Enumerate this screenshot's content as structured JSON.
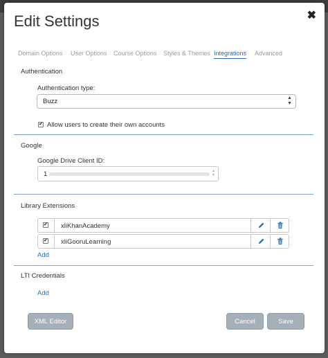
{
  "dialog": {
    "title": "Edit Settings",
    "close_glyph": "✖"
  },
  "tabs": [
    {
      "label": "Domain Options",
      "active": false
    },
    {
      "label": "User Options",
      "active": false
    },
    {
      "label": "Course Options",
      "active": false
    },
    {
      "label": "Styles & Themes",
      "active": false
    },
    {
      "label": "Integrations",
      "active": true
    },
    {
      "label": "Advanced",
      "active": false
    }
  ],
  "authentication": {
    "section_title": "Authentication",
    "type_label": "Authentication type:",
    "type_value": "Buzz",
    "allow_accounts_label": "Allow users to create their own accounts",
    "allow_accounts_checked": true
  },
  "google": {
    "section_title": "Google",
    "client_id_label": "Google Drive Client ID:",
    "client_id_visible_prefix": "1"
  },
  "library_extensions": {
    "section_title": "Library Extensions",
    "items": [
      {
        "name": "xliKhanAcademy",
        "checked": true
      },
      {
        "name": "xliGooruLearning",
        "checked": true
      }
    ],
    "add_label": "Add"
  },
  "lti": {
    "section_title": "LTI Credentials",
    "add_label": "Add"
  },
  "footer": {
    "xml_editor_label": "XML Editor",
    "cancel_label": "Cancel",
    "save_label": "Save"
  },
  "colors": {
    "accent": "#2b6cb0",
    "divider": "#7aa3d6",
    "button_bg": "#a6afb8",
    "backdrop": "#5d5d5d"
  },
  "icons": {
    "edit": "pencil-icon",
    "delete": "trash-icon",
    "close": "close-icon",
    "select_arrows": "chevron-up-down-icon",
    "checkbox": "checkmark-icon"
  }
}
